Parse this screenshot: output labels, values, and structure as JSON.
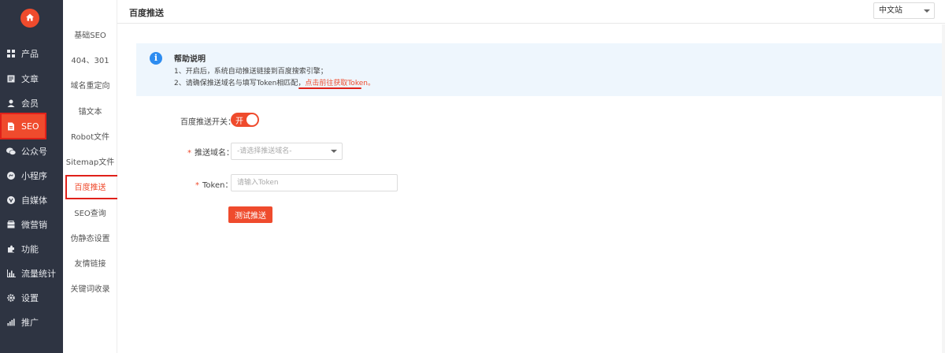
{
  "topbar": {
    "title": "百度推送",
    "language": "中文站"
  },
  "sidebar": {
    "items": [
      {
        "label": "产品",
        "icon": "grid-icon"
      },
      {
        "label": "文章",
        "icon": "document-icon"
      },
      {
        "label": "会员",
        "icon": "user-icon"
      },
      {
        "label": "SEO",
        "icon": "file-icon"
      },
      {
        "label": "公众号",
        "icon": "wechat-icon"
      },
      {
        "label": "小程序",
        "icon": "mini-program-icon"
      },
      {
        "label": "自媒体",
        "icon": "media-icon"
      },
      {
        "label": "微营销",
        "icon": "marketing-icon"
      },
      {
        "label": "功能",
        "icon": "puzzle-icon"
      },
      {
        "label": "流量统计",
        "icon": "bar-chart-icon"
      },
      {
        "label": "设置",
        "icon": "gear-icon"
      },
      {
        "label": "推广",
        "icon": "promote-icon"
      }
    ],
    "active": "SEO"
  },
  "submenu": {
    "items": [
      "基础SEO",
      "404、301",
      "域名重定向",
      "锚文本",
      "Robot文件",
      "Sitemap文件",
      "百度推送",
      "SEO查询",
      "伪静态设置",
      "友情链接",
      "关键词收录"
    ],
    "active": "百度推送"
  },
  "help": {
    "title": "帮助说明",
    "line1": "1、开启后，系统自动推送链接到百度搜索引擎；",
    "line2": "2、请确保推送域名与填写Token相匹配，",
    "link": "点击前往获取Token。"
  },
  "form": {
    "switch_label": "百度推送开关：",
    "switch_text": "开",
    "switch_on": true,
    "domain_label": "推送域名：",
    "domain_placeholder": "-请选择推送域名-",
    "token_label": "Token：",
    "token_placeholder": "请输入Token",
    "submit_label": "测试推送"
  },
  "colors": {
    "accent": "#ef4b2d",
    "sidebar_bg": "#2e3442",
    "info_bg": "#eef6fd",
    "info_icon": "#2d8cf0"
  }
}
